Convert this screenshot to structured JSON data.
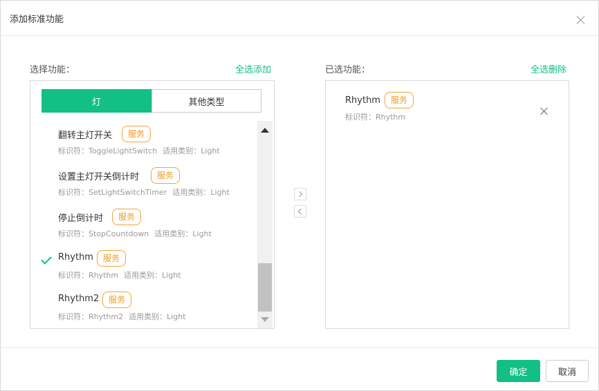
{
  "dialog": {
    "title": "添加标准功能"
  },
  "left": {
    "label": "选择功能：",
    "select_all": "全选添加",
    "tabs": [
      {
        "label": "灯",
        "active": true
      },
      {
        "label": "其他类型",
        "active": false
      }
    ],
    "items": [
      {
        "name": "翻转主灯开关",
        "badge": "服务",
        "id_label": "标识符：ToggleLightSwitch",
        "type_label": "适用类别：Light",
        "checked": false
      },
      {
        "name": "设置主灯开关倒计时",
        "badge": "服务",
        "id_label": "标识符：SetLightSwitchTimer",
        "type_label": "适用类别：Light",
        "checked": false
      },
      {
        "name": "停止倒计时",
        "badge": "服务",
        "id_label": "标识符：StopCountdown",
        "type_label": "适用类别：Light",
        "checked": false
      },
      {
        "name": "Rhythm",
        "badge": "服务",
        "id_label": "标识符：Rhythm",
        "type_label": "适用类别：Light",
        "checked": true
      },
      {
        "name": "Rhythm2",
        "badge": "服务",
        "id_label": "标识符：Rhythm2",
        "type_label": "适用类别：Light",
        "checked": false
      }
    ]
  },
  "right": {
    "label": "已选功能：",
    "remove_all": "全选删除",
    "items": [
      {
        "name": "Rhythm",
        "badge": "服务",
        "id_label": "标识符：Rhythm"
      }
    ]
  },
  "footer": {
    "ok_label": "确定",
    "cancel_label": "取消"
  },
  "colors": {
    "accent": "#12bf85",
    "badge": "#f29a1f"
  }
}
